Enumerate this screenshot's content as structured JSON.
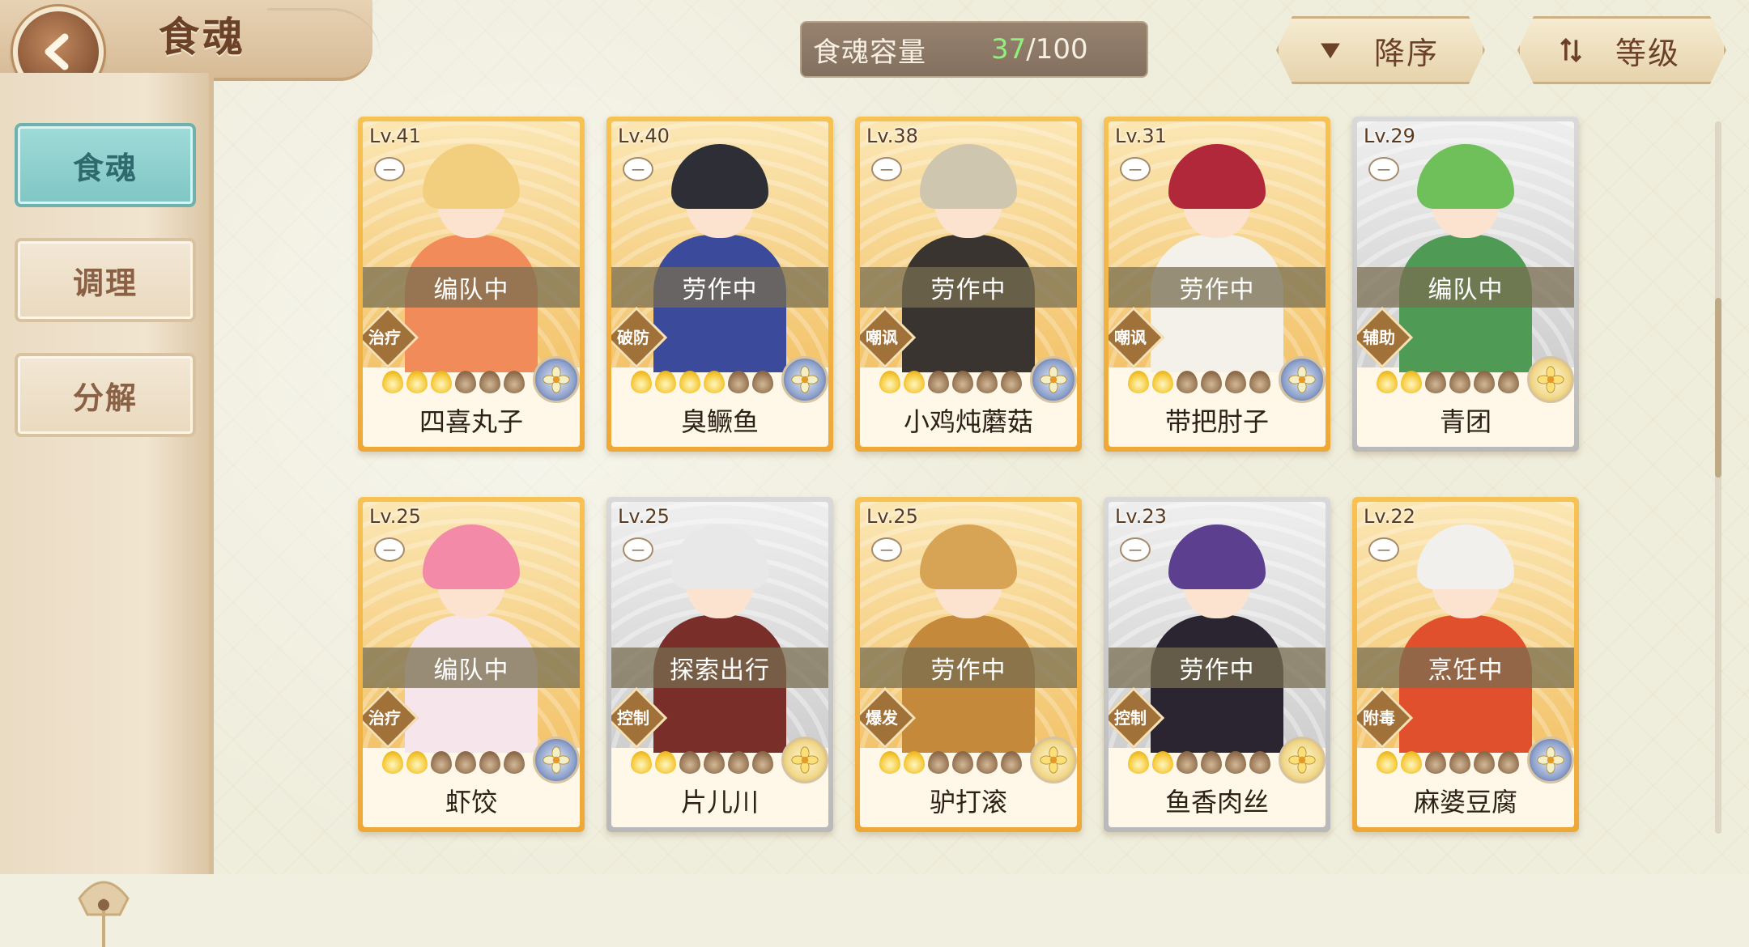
{
  "header": {
    "title": "食魂",
    "back_label": "back"
  },
  "sidebar": {
    "items": [
      {
        "label": "食魂",
        "active": true
      },
      {
        "label": "调理",
        "active": false
      },
      {
        "label": "分解",
        "active": false
      }
    ]
  },
  "capacity": {
    "label": "食魂容量",
    "current": "37",
    "separator": "/",
    "max": "100",
    "current_color": "#8ff07a"
  },
  "sort": {
    "order_label": "降序",
    "order_icon": "triangle-down-icon",
    "field_label": "等级",
    "field_icon": "sort-arrows-icon"
  },
  "scroll": {
    "position_fraction": 0.25
  },
  "cards": [
    {
      "level": "Lv.41",
      "rank": "一",
      "status": "编队中",
      "role": "治疗",
      "stars": 3,
      "element": "blue",
      "name": "四喜丸子",
      "frame": "gold",
      "hair": "#f2cf7f",
      "outfit": "#f28b5a"
    },
    {
      "level": "Lv.40",
      "rank": "一",
      "status": "劳作中",
      "role": "破防",
      "stars": 4,
      "element": "blue",
      "name": "臭鳜鱼",
      "frame": "gold",
      "hair": "#2e2e36",
      "outfit": "#3b4a9a"
    },
    {
      "level": "Lv.38",
      "rank": "一",
      "status": "劳作中",
      "role": "嘲讽",
      "stars": 2,
      "element": "blue",
      "name": "小鸡炖蘑菇",
      "frame": "gold",
      "hair": "#cfc6b0",
      "outfit": "#3a3430"
    },
    {
      "level": "Lv.31",
      "rank": "一",
      "status": "劳作中",
      "role": "嘲讽",
      "stars": 2,
      "element": "blue",
      "name": "带把肘子",
      "frame": "gold",
      "hair": "#b0283a",
      "outfit": "#f4f0ea"
    },
    {
      "level": "Lv.29",
      "rank": "一",
      "status": "编队中",
      "role": "辅助",
      "stars": 2,
      "element": "yellow",
      "name": "青团",
      "frame": "silver",
      "hair": "#6fbf5a",
      "outfit": "#4f9a54"
    },
    {
      "level": "Lv.25",
      "rank": "一",
      "status": "编队中",
      "role": "治疗",
      "stars": 2,
      "element": "blue",
      "name": "虾饺",
      "frame": "gold",
      "hair": "#f28aa8",
      "outfit": "#f7e5ec"
    },
    {
      "level": "Lv.25",
      "rank": "一",
      "status": "探索出行",
      "role": "控制",
      "stars": 2,
      "element": "yellow",
      "name": "片儿川",
      "frame": "silver",
      "hair": "#e8e8e8",
      "outfit": "#7a2e2a"
    },
    {
      "level": "Lv.25",
      "rank": "一",
      "status": "劳作中",
      "role": "爆发",
      "stars": 2,
      "element": "yellow",
      "name": "驴打滚",
      "frame": "gold",
      "hair": "#d7a455",
      "outfit": "#c4893b"
    },
    {
      "level": "Lv.23",
      "rank": "一",
      "status": "劳作中",
      "role": "控制",
      "stars": 2,
      "element": "yellow",
      "name": "鱼香肉丝",
      "frame": "silver",
      "hair": "#5c3f8f",
      "outfit": "#2a2530"
    },
    {
      "level": "Lv.22",
      "rank": "一",
      "status": "烹饪中",
      "role": "附毒",
      "stars": 2,
      "element": "blue",
      "name": "麻婆豆腐",
      "frame": "gold",
      "hair": "#f2f0ec",
      "outfit": "#e0502c"
    }
  ]
}
